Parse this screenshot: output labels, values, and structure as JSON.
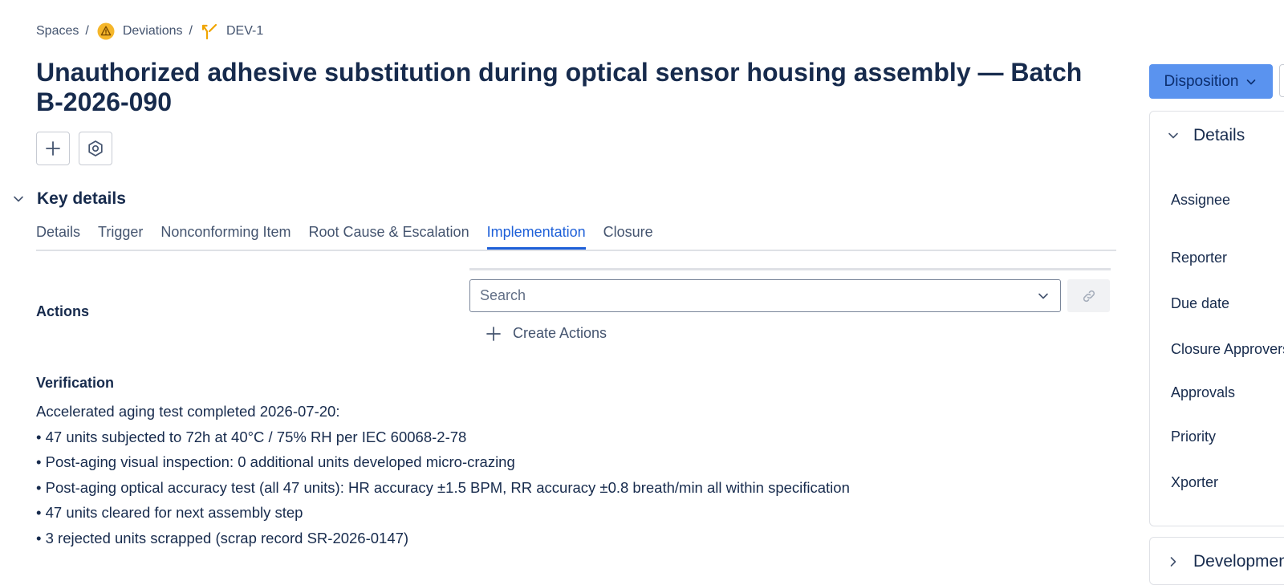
{
  "breadcrumb": {
    "spaces": "Spaces",
    "separator": "/",
    "deviations": "Deviations",
    "issue_key": "DEV-1"
  },
  "title": "Unauthorized adhesive substitution during optical sensor housing assembly — Batch B-2026-090",
  "key_details": {
    "heading": "Key details",
    "tabs": [
      {
        "label": "Details"
      },
      {
        "label": "Trigger"
      },
      {
        "label": "Nonconforming Item"
      },
      {
        "label": "Root Cause & Escalation"
      },
      {
        "label": "Implementation",
        "active": true
      },
      {
        "label": "Closure"
      }
    ]
  },
  "actions": {
    "label": "Actions",
    "search_placeholder": "Search",
    "create_label": "Create Actions"
  },
  "verification": {
    "label": "Verification",
    "lines": [
      "Accelerated aging test completed 2026-07-20:",
      "• 47 units subjected to 72h at 40°C / 75% RH per IEC 60068-2-78",
      "• Post-aging visual inspection: 0 additional units developed micro-crazing",
      "• Post-aging optical accuracy test (all 47 units): HR accuracy ±1.5 BPM, RR accuracy ±0.8 breath/min all within specification",
      "• 47 units cleared for next assembly step",
      "• 3 rejected units scrapped (scrap record SR-2026-0147)"
    ]
  },
  "sidebar": {
    "disposition_label": "Disposition",
    "details_heading": "Details",
    "fields": [
      {
        "label": "Assignee"
      },
      {
        "label": "Reporter"
      },
      {
        "label": "Due date"
      },
      {
        "label": "Closure Approvers"
      },
      {
        "label": "Approvals"
      },
      {
        "label": "Priority"
      },
      {
        "label": "Xporter"
      }
    ],
    "development_heading": "Development"
  },
  "colors": {
    "primary": "#5a93ef",
    "tab_active": "#1d5fd8",
    "text": "#172b4d",
    "muted": "#44546f",
    "warning_icon": "#f5b62a"
  }
}
